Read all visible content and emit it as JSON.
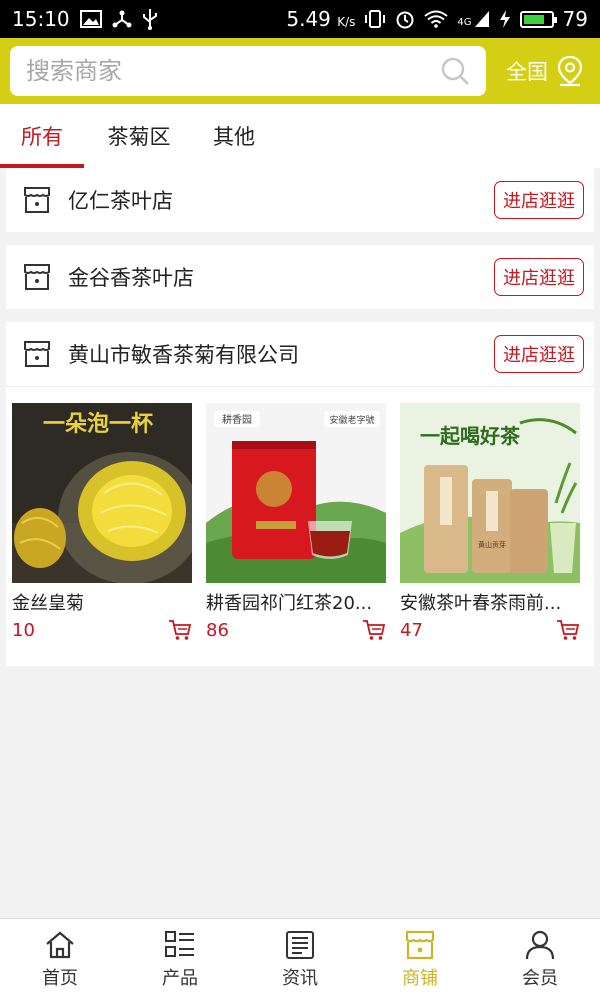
{
  "status_bar": {
    "time": "15:10",
    "network_speed": "5.49",
    "network_speed_unit": "K/s",
    "network_type": "4G",
    "battery": "79",
    "battery_level": 0.79
  },
  "search": {
    "placeholder": "搜索商家"
  },
  "region": {
    "label": "全国"
  },
  "tabs": [
    {
      "label": "所有",
      "active": true
    },
    {
      "label": "茶菊区",
      "active": false
    },
    {
      "label": "其他",
      "active": false
    }
  ],
  "shops": [
    {
      "name": "亿仁茶叶店",
      "button": "进店逛逛"
    },
    {
      "name": "金谷香茶叶店",
      "button": "进店逛逛"
    },
    {
      "name": "黄山市敏香茶菊有限公司",
      "button": "进店逛逛",
      "products": [
        {
          "name": "金丝皇菊",
          "price": "10",
          "image_text": "一朵泡一杯"
        },
        {
          "name": "耕香园祁门红茶20...",
          "price": "86",
          "image_text": "耕香园",
          "image_text2": "安徽老字號"
        },
        {
          "name": "安徽茶叶春茶雨前...",
          "price": "47",
          "image_text": "一起喝好茶",
          "image_text2": "黄山贡芽"
        }
      ]
    }
  ],
  "bottom_nav": [
    {
      "label": "首页",
      "icon": "home-icon",
      "active": false
    },
    {
      "label": "产品",
      "icon": "product-list-icon",
      "active": false
    },
    {
      "label": "资讯",
      "icon": "news-icon",
      "active": false
    },
    {
      "label": "商铺",
      "icon": "shop-icon",
      "active": true
    },
    {
      "label": "会员",
      "icon": "member-icon",
      "active": false
    }
  ],
  "colors": {
    "header": "#d4cf14",
    "accent_red": "#c8161d",
    "nav_active": "#c9b52a"
  }
}
